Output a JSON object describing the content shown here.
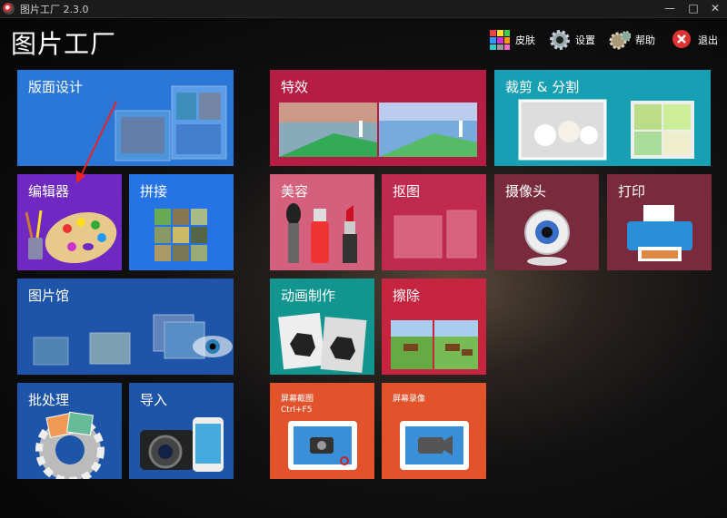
{
  "window": {
    "title": "图片工厂 2.3.0"
  },
  "app": {
    "title": "图片工厂"
  },
  "toolbar": {
    "skin": "皮肤",
    "settings": "设置",
    "help": "帮助",
    "exit": "退出"
  },
  "tiles": {
    "layout": "版面设计",
    "effects": "特效",
    "crop": "裁剪 & 分割",
    "editor": "编辑器",
    "collage": "拼接",
    "beauty": "美容",
    "cutout": "抠图",
    "camera": "摄像头",
    "print": "打印",
    "gallery": "图片馆",
    "animation": "动画制作",
    "erase": "擦除",
    "batch": "批处理",
    "import": "导入",
    "screenshot": "屏幕截图",
    "screenshot_hotkey": "Ctrl+F5",
    "screenrec": "屏幕录像"
  },
  "colors": {
    "blue": "#2a77d8",
    "purple": "#7028c3",
    "blue2": "#2674e4",
    "darkblue": "#1e55a8",
    "crimson": "#b51d45",
    "teal": "#17a0b3",
    "pink": "#d4607e",
    "rose": "#c02a4f",
    "wine": "#7a2a3d",
    "teal2": "#12958f",
    "red": "#c62540",
    "orange": "#e2532c"
  }
}
